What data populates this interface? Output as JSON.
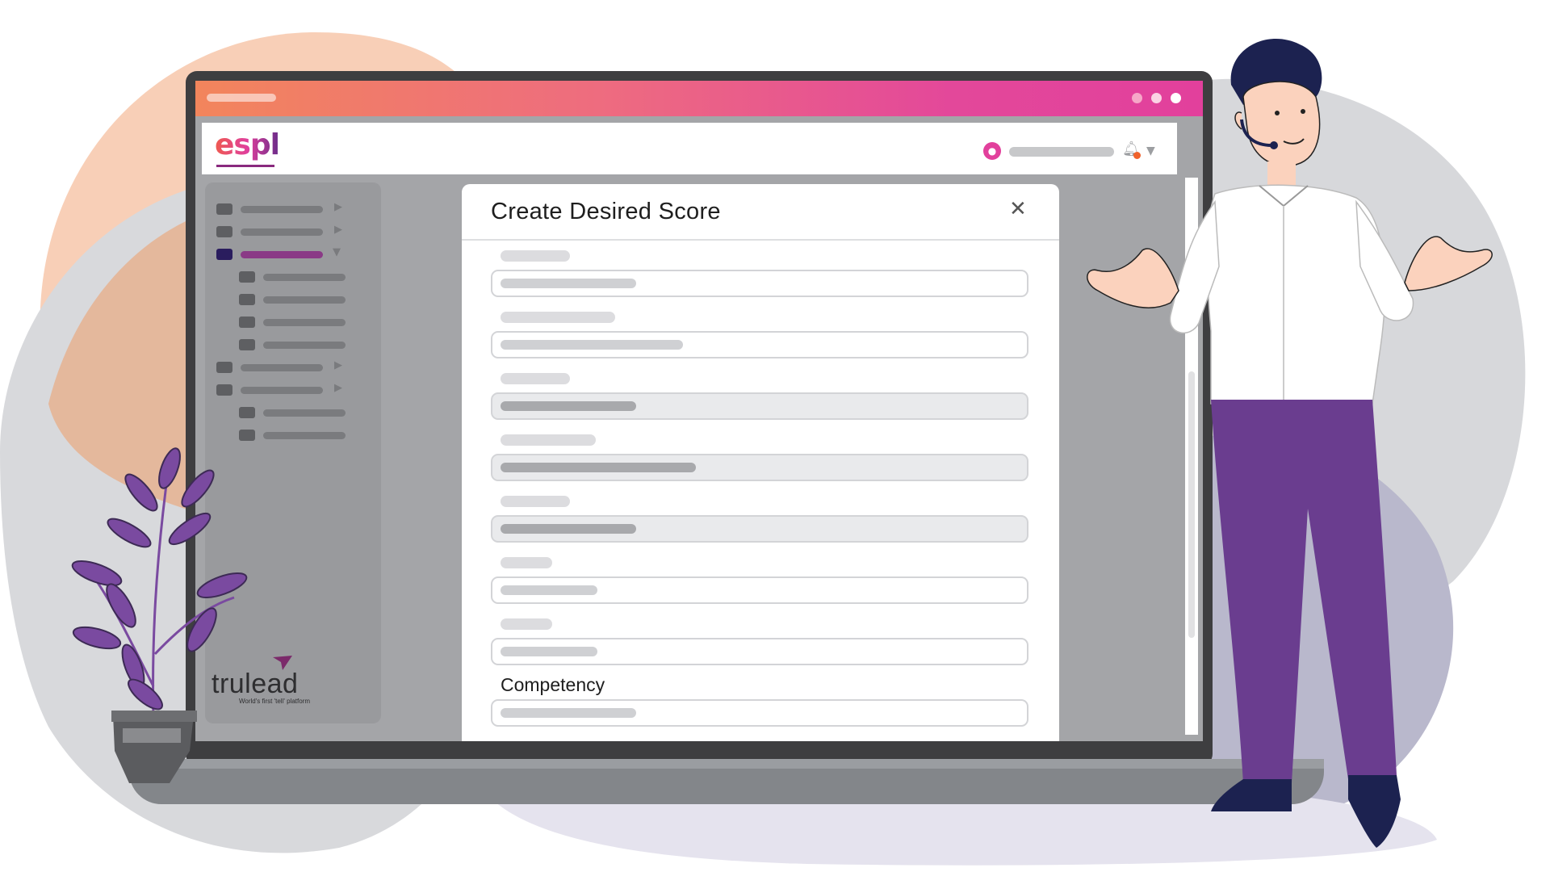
{
  "app": {
    "logo_text": "espl",
    "brand_gradient": [
      "#f2855c",
      "#e2409c"
    ]
  },
  "modal": {
    "title": "Create Desired Score",
    "close_glyph": "✕",
    "competency_label": "Competency"
  },
  "footer_brand": {
    "name": "trulead",
    "tagline": "World's first 'tell' platform"
  },
  "icons": {
    "user": "user-icon",
    "bell": "bell-icon",
    "caret": "chevron-down-icon",
    "close": "close-icon"
  },
  "colors": {
    "titlebar_start": "#f2855c",
    "titlebar_end": "#e2409c",
    "active_nav": "#2a1d5e",
    "active_nav_bar": "#8a3a86",
    "pants": "#6a3d8f",
    "plant": "#7a4aa0"
  }
}
